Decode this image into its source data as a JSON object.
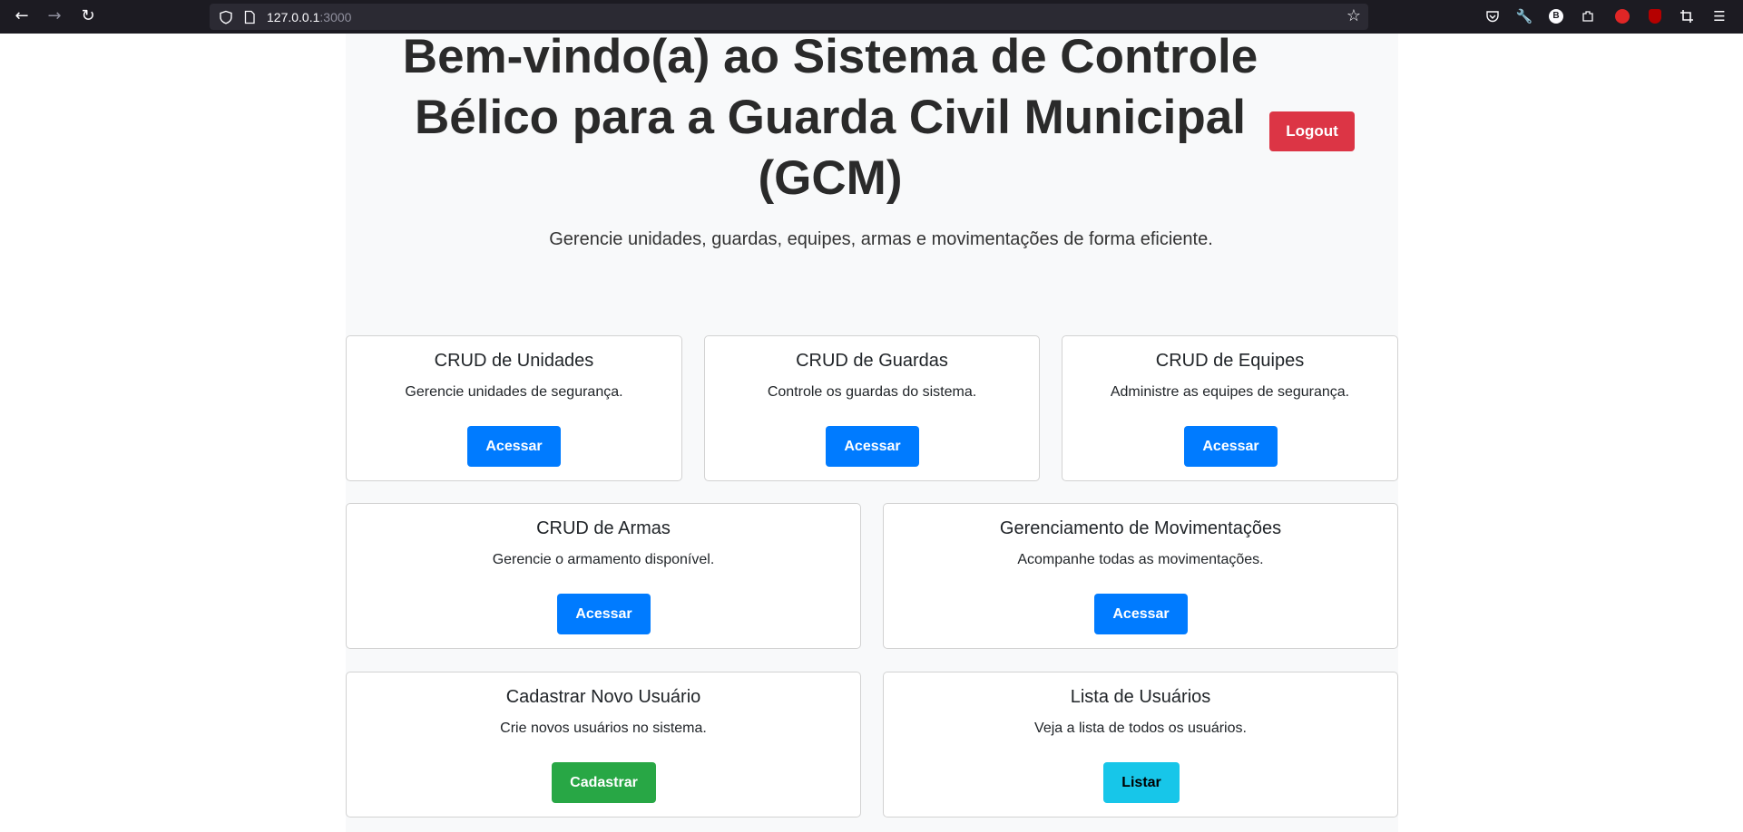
{
  "browser": {
    "url_host": "127.0.0.1",
    "url_port": ":3000"
  },
  "page": {
    "title": "Bem-vindo(a) ao Sistema de Controle Bélico para a Guarda Civil Municipal (GCM)",
    "subtitle": "Gerencie unidades, guardas, equipes, armas e movimentações de forma eficiente.",
    "logout_label": "Logout"
  },
  "cards": [
    {
      "title": "CRUD de Unidades",
      "text": "Gerencie unidades de segurança.",
      "button": "Acessar"
    },
    {
      "title": "CRUD de Guardas",
      "text": "Controle os guardas do sistema.",
      "button": "Acessar"
    },
    {
      "title": "CRUD de Equipes",
      "text": "Administre as equipes de segurança.",
      "button": "Acessar"
    },
    {
      "title": "CRUD de Armas",
      "text": "Gerencie o armamento disponível.",
      "button": "Acessar"
    },
    {
      "title": "Gerenciamento de Movimentações",
      "text": "Acompanhe todas as movimentações.",
      "button": "Acessar"
    },
    {
      "title": "Cadastrar Novo Usuário",
      "text": "Crie novos usuários no sistema.",
      "button": "Cadastrar"
    },
    {
      "title": "Lista de Usuários",
      "text": "Veja a lista de todos os usuários.",
      "button": "Listar"
    }
  ],
  "colors": {
    "primary": "#007bff",
    "danger": "#dc3545",
    "success": "#28a745",
    "info": "#17c6e9"
  }
}
